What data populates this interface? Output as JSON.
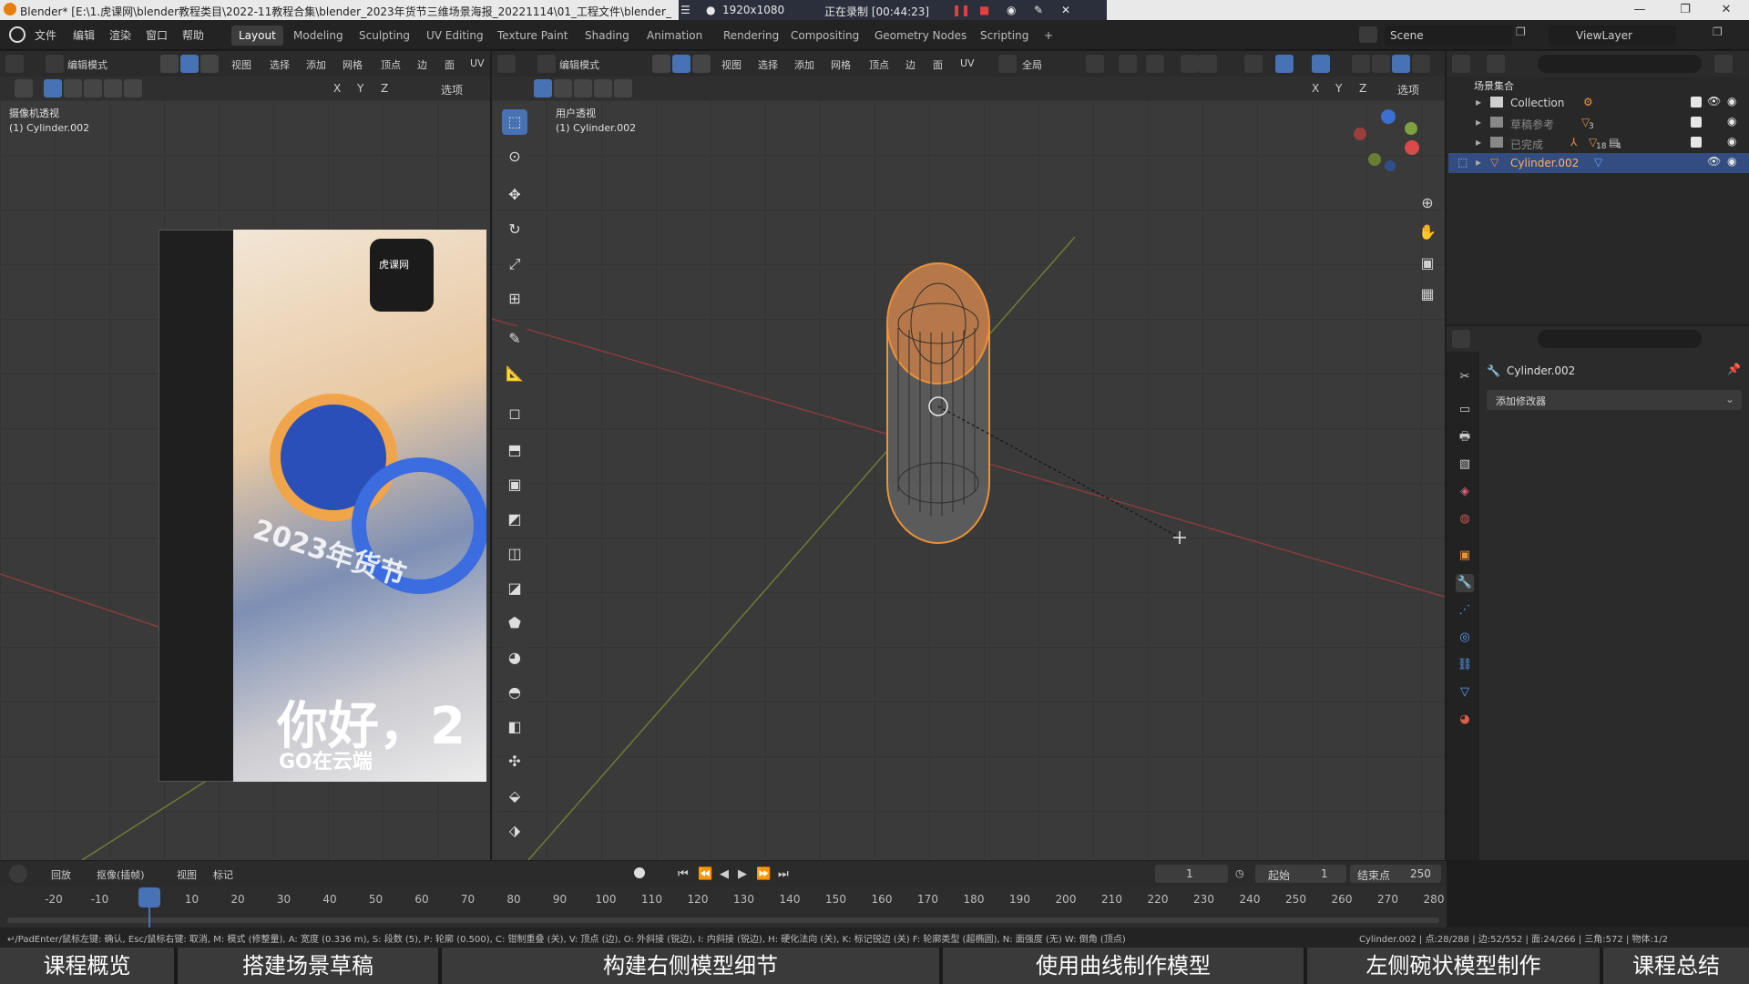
{
  "titlebar": {
    "title": "Blender* [E:\\1.虎课网\\blender教程类目\\2022-11教程合集\\blender_2023年货节三维场景海报_20221114\\01_工程文件\\blender_",
    "resolution": "1920x1080",
    "recording": "正在录制 [00:44:23]",
    "window_minimize": "—",
    "window_restore": "❐",
    "window_close": "✕"
  },
  "menubar": {
    "items": [
      "文件",
      "编辑",
      "渲染",
      "窗口",
      "帮助"
    ],
    "workspaces": [
      "Layout",
      "Modeling",
      "Sculpting",
      "UV Editing",
      "Texture Paint",
      "Shading",
      "Animation",
      "Rendering",
      "Compositing",
      "Geometry Nodes",
      "Scripting"
    ],
    "active_workspace": "Layout",
    "add_workspace": "+",
    "scene_label": "Scene",
    "viewlayer_label": "ViewLayer"
  },
  "left_viewport": {
    "mode": "编辑模式",
    "menus": [
      "视图",
      "选择",
      "添加",
      "网格",
      "顶点",
      "边",
      "面",
      "UV"
    ],
    "axes": [
      "X",
      "Y",
      "Z"
    ],
    "options": "选项",
    "view_name": "摄像机透视",
    "object_name": "(1) Cylinder.002",
    "poster_title": "你好，2",
    "poster_sub": "GO在云端",
    "poster_year": "2023年货节",
    "watch_logo": "虎课网"
  },
  "main_viewport": {
    "mode": "编辑模式",
    "menus": [
      "视图",
      "选择",
      "添加",
      "网格",
      "顶点",
      "边",
      "面",
      "UV"
    ],
    "transform": "全局",
    "options": "选项",
    "axes": [
      "X",
      "Y",
      "Z"
    ],
    "view_name": "用户透视",
    "object_name": "(1) Cylinder.002"
  },
  "outliner": {
    "root": "场景集合",
    "rows": [
      {
        "name": "Collection"
      },
      {
        "name": "草稿参考"
      },
      {
        "name": "已完成"
      },
      {
        "name": "Cylinder.002"
      }
    ],
    "badges": [
      "3",
      "18",
      "4"
    ]
  },
  "properties": {
    "object_name": "Cylinder.002",
    "add_modifier": "添加修改器"
  },
  "timeline": {
    "menus": [
      "回放",
      "抠像(插帧)",
      "视图",
      "标记"
    ],
    "current_frame": "1",
    "start_label": "起始",
    "start_value": "1",
    "end_label": "结束点",
    "end_value": "250",
    "ticks": [
      "-20",
      "-10",
      "1",
      "10",
      "20",
      "30",
      "40",
      "50",
      "60",
      "70",
      "80",
      "90",
      "100",
      "110",
      "120",
      "130",
      "140",
      "150",
      "160",
      "170",
      "180",
      "190",
      "200",
      "210",
      "220",
      "230",
      "240",
      "250",
      "260",
      "270",
      "280"
    ]
  },
  "statusbar": {
    "left": "↵/PadEnter/鼠标左键: 确认, Esc/鼠标右键: 取消, M: 模式 (修整量), A: 宽度 (0.336 m), S: 段数 (5), P: 轮廓 (0.500), C: 钳制重叠 (关), V: 顶点 (边), O: 外斜接 (锐边), I: 内斜接 (锐边), H: 硬化法向 (关), K: 标记锐边 (关) F: 轮廓类型 (超椭圆), N: 面强度 (无) W: 倒角 (顶点)",
    "right": "Cylinder.002 | 点:28/288 | 边:52/552 | 面:24/266 | 三角:572 | 物体:1/2"
  },
  "chapters": [
    "课程概览",
    "搭建场景草稿",
    "构建右侧模型细节",
    "使用曲线制作模型",
    "左侧碗状模型制作",
    "课程总结"
  ],
  "colors": {
    "accent": "#4772b3",
    "selection_orange": "#e8913b",
    "x_axis": "#b04a4a",
    "y_axis": "#8aa03a"
  }
}
